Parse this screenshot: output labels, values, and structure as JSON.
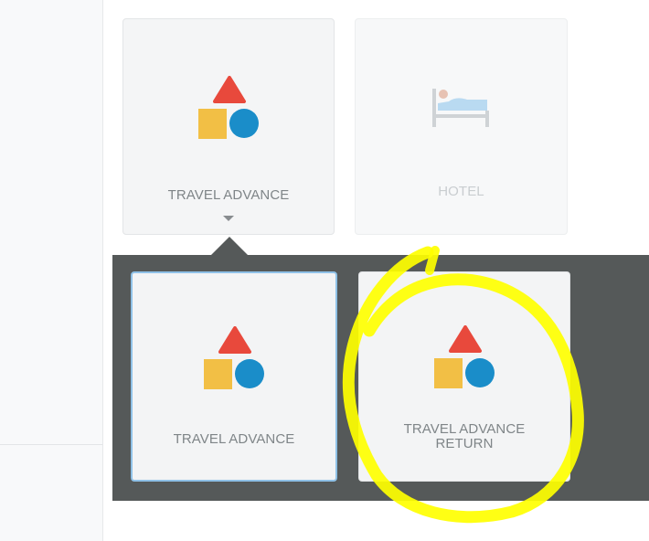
{
  "categories": [
    {
      "label": "TRAVEL ADVANCE",
      "icon": "shapes-icon"
    },
    {
      "label": "HOTEL",
      "icon": "bed-icon"
    }
  ],
  "subcategories": [
    {
      "label": "TRAVEL ADVANCE",
      "icon": "shapes-icon",
      "selected": true
    },
    {
      "label_line1": "TRAVEL ADVANCE",
      "label_line2": "RETURN",
      "icon": "shapes-icon",
      "selected": false
    }
  ],
  "colors": {
    "triangle": "#e8493c",
    "square": "#f2bf45",
    "circle": "#1a8dc9",
    "panel": "#555959",
    "selected_border": "#8fc1e7",
    "highlight": "#ffff00"
  }
}
